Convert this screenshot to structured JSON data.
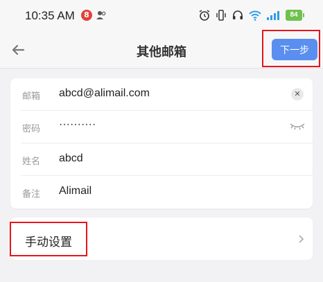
{
  "status_bar": {
    "time": "10:35 AM",
    "notification_count": "8",
    "battery": "84"
  },
  "nav": {
    "title": "其他邮箱",
    "next_label": "下一步"
  },
  "form": {
    "email": {
      "label": "邮箱",
      "value": "abcd@alimail.com"
    },
    "password": {
      "label": "密码",
      "value": "··········"
    },
    "name": {
      "label": "姓名",
      "value": "abcd"
    },
    "note": {
      "label": "备注",
      "value": "Alimail"
    }
  },
  "manual": {
    "label": "手动设置"
  },
  "colors": {
    "accent": "#5a8ff0",
    "highlight": "#e8141a",
    "battery": "#6fc24d"
  }
}
